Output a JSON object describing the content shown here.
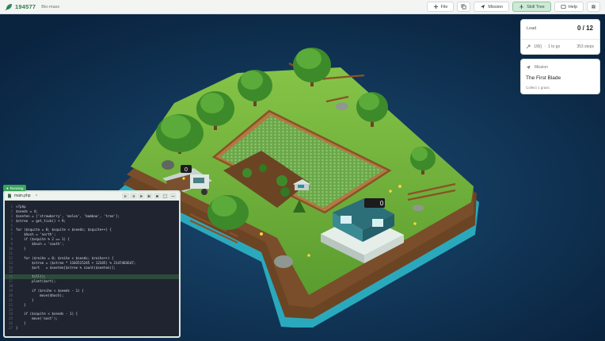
{
  "app": {
    "id": "194577",
    "name": "Bio-mass"
  },
  "toolbar": {
    "file_label": "File",
    "mission_label": "Mission",
    "skill_tree_label": "Skill Tree",
    "help_label": "Help"
  },
  "load_panel": {
    "title": "Load",
    "count": "0 / 12",
    "progress_left": "1/8()",
    "progress_to_go": "1 to go",
    "steps": "353 steps"
  },
  "mission_panel": {
    "label": "Mission",
    "title": "The First Blade",
    "subtitle": "Collect 1 grass"
  },
  "scene": {
    "truck_badge": "0",
    "building_badge": "0"
  },
  "editor": {
    "status": "Running",
    "file_name": "main.php",
    "close_symbol": "×",
    "lines": [
      {
        "n": "1",
        "t": "<?php"
      },
      {
        "n": "2",
        "t": "$seeds = 4;"
      },
      {
        "n": "3",
        "t": "$seeten = ['strawberry', 'melon', 'bamboo', 'tree'];"
      },
      {
        "n": "4",
        "t": "$stree  = get_tick() + 9;"
      },
      {
        "n": "5",
        "t": ""
      },
      {
        "n": "6",
        "t": "for ($squite = 0; $squite < $seeds; $squite++) {"
      },
      {
        "n": "7",
        "t": "    $hoch = 'north';"
      },
      {
        "n": "8",
        "t": "    if ($squite % 2 == 1) {"
      },
      {
        "n": "9",
        "t": "        $hoch = 'south';"
      },
      {
        "n": "10",
        "t": "    }"
      },
      {
        "n": "11",
        "t": ""
      },
      {
        "n": "12",
        "t": "    for ($reihe = 0; $reihe < $seeds; $reihe++) {"
      },
      {
        "n": "13",
        "t": "        $stree = ($stree * 1103515245 + 12345) % 2147483647;"
      },
      {
        "n": "14",
        "t": "        $art   = $seeten[$stree % count($seeten)];"
      },
      {
        "n": "15",
        "t": ""
      },
      {
        "n": "16",
        "t": "        till();"
      },
      {
        "n": "17",
        "t": "        plant($art);"
      },
      {
        "n": "18",
        "t": ""
      },
      {
        "n": "19",
        "t": "        if ($reihe < $seeds - 1) {"
      },
      {
        "n": "20",
        "t": "            move($hoch);"
      },
      {
        "n": "21",
        "t": "        }"
      },
      {
        "n": "22",
        "t": "    }"
      },
      {
        "n": "23",
        "t": ""
      },
      {
        "n": "24",
        "t": "    if ($squite < $seeds - 1) {"
      },
      {
        "n": "25",
        "t": "        move('east');"
      },
      {
        "n": "26",
        "t": "    }"
      },
      {
        "n": "27",
        "t": "}"
      }
    ]
  },
  "colors": {
    "background": "#0d2c4a",
    "grass": "#6fb23a",
    "soil": "#6b4424",
    "water": "#2bb5c8",
    "accent": "#2e8b57",
    "editor_bg": "#1f2430"
  },
  "icons": [
    "leaf-icon",
    "plus-icon",
    "copy-icon",
    "send-icon",
    "tree-icon",
    "question-icon",
    "gear-icon",
    "step-icon",
    "file-icon"
  ]
}
